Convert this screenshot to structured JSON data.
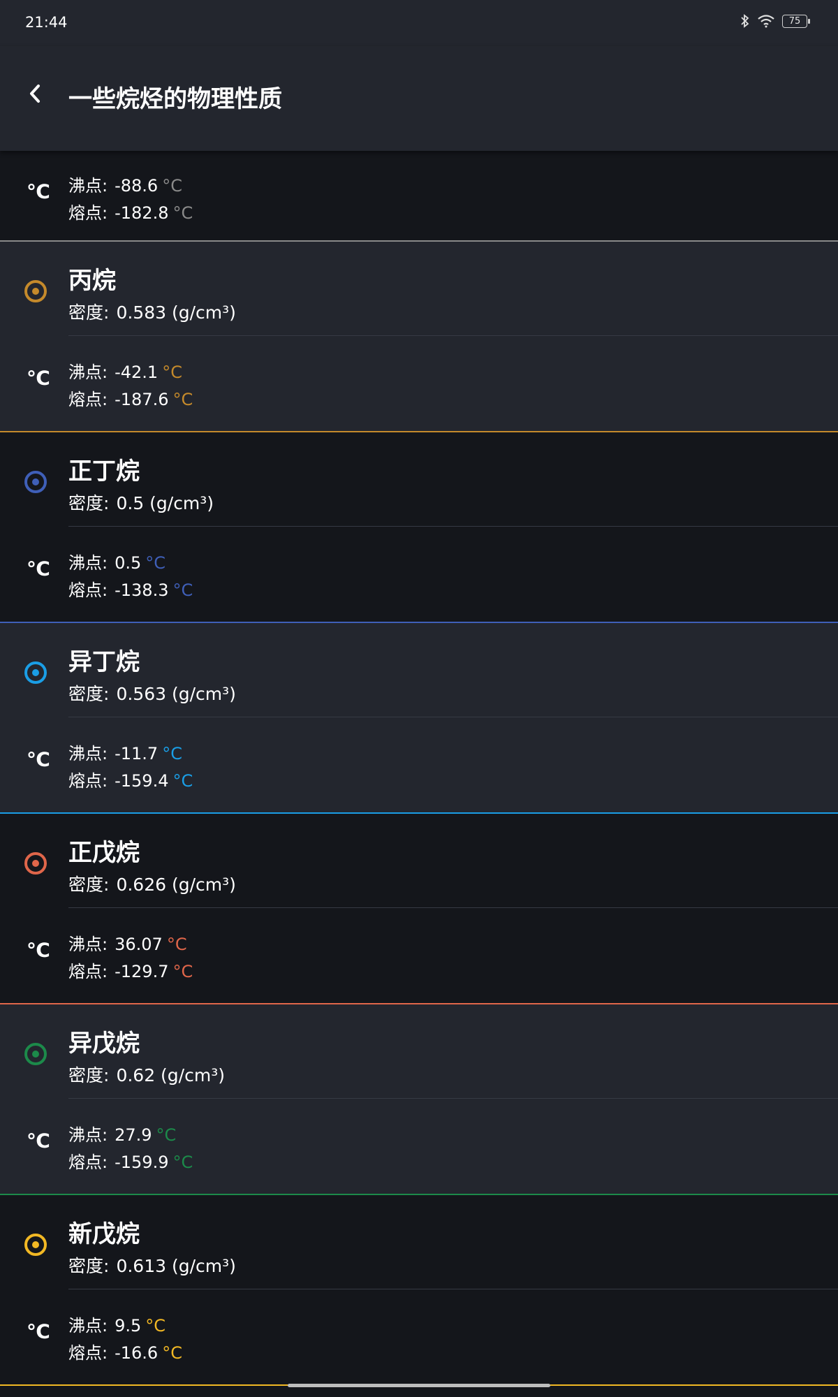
{
  "status": {
    "time": "21:44",
    "battery": "75"
  },
  "header": {
    "title": "一些烷烃的物理性质"
  },
  "labels": {
    "density": "密度:",
    "boiling": "沸点:",
    "melting": "熔点:",
    "degree_icon": "℃"
  },
  "first_item": {
    "boiling": "-88.6",
    "melting": "-182.8",
    "unit": "°C",
    "color": "#8a8a8a"
  },
  "items": [
    {
      "name": "丙烷",
      "density": "0.583 (g/cm³)",
      "boiling": "-42.1",
      "melting": "-187.6",
      "unit": "°C",
      "color": "#c58a2b"
    },
    {
      "name": "正丁烷",
      "density": "0.5 (g/cm³)",
      "boiling": "0.5",
      "melting": "-138.3",
      "unit": "°C",
      "color": "#3f5fb8"
    },
    {
      "name": "异丁烷",
      "density": "0.563 (g/cm³)",
      "boiling": "-11.7",
      "melting": "-159.4",
      "unit": "°C",
      "color": "#1a9ee6"
    },
    {
      "name": "正戊烷",
      "density": "0.626 (g/cm³)",
      "boiling": "36.07",
      "melting": "-129.7",
      "unit": "°C",
      "color": "#e0664a"
    },
    {
      "name": "异戊烷",
      "density": "0.62 (g/cm³)",
      "boiling": "27.9",
      "melting": "-159.9",
      "unit": "°C",
      "color": "#1c8a4a"
    },
    {
      "name": "新戊烷",
      "density": "0.613 (g/cm³)",
      "boiling": "9.5",
      "melting": "-16.6",
      "unit": "°C",
      "color": "#f2b824"
    }
  ]
}
